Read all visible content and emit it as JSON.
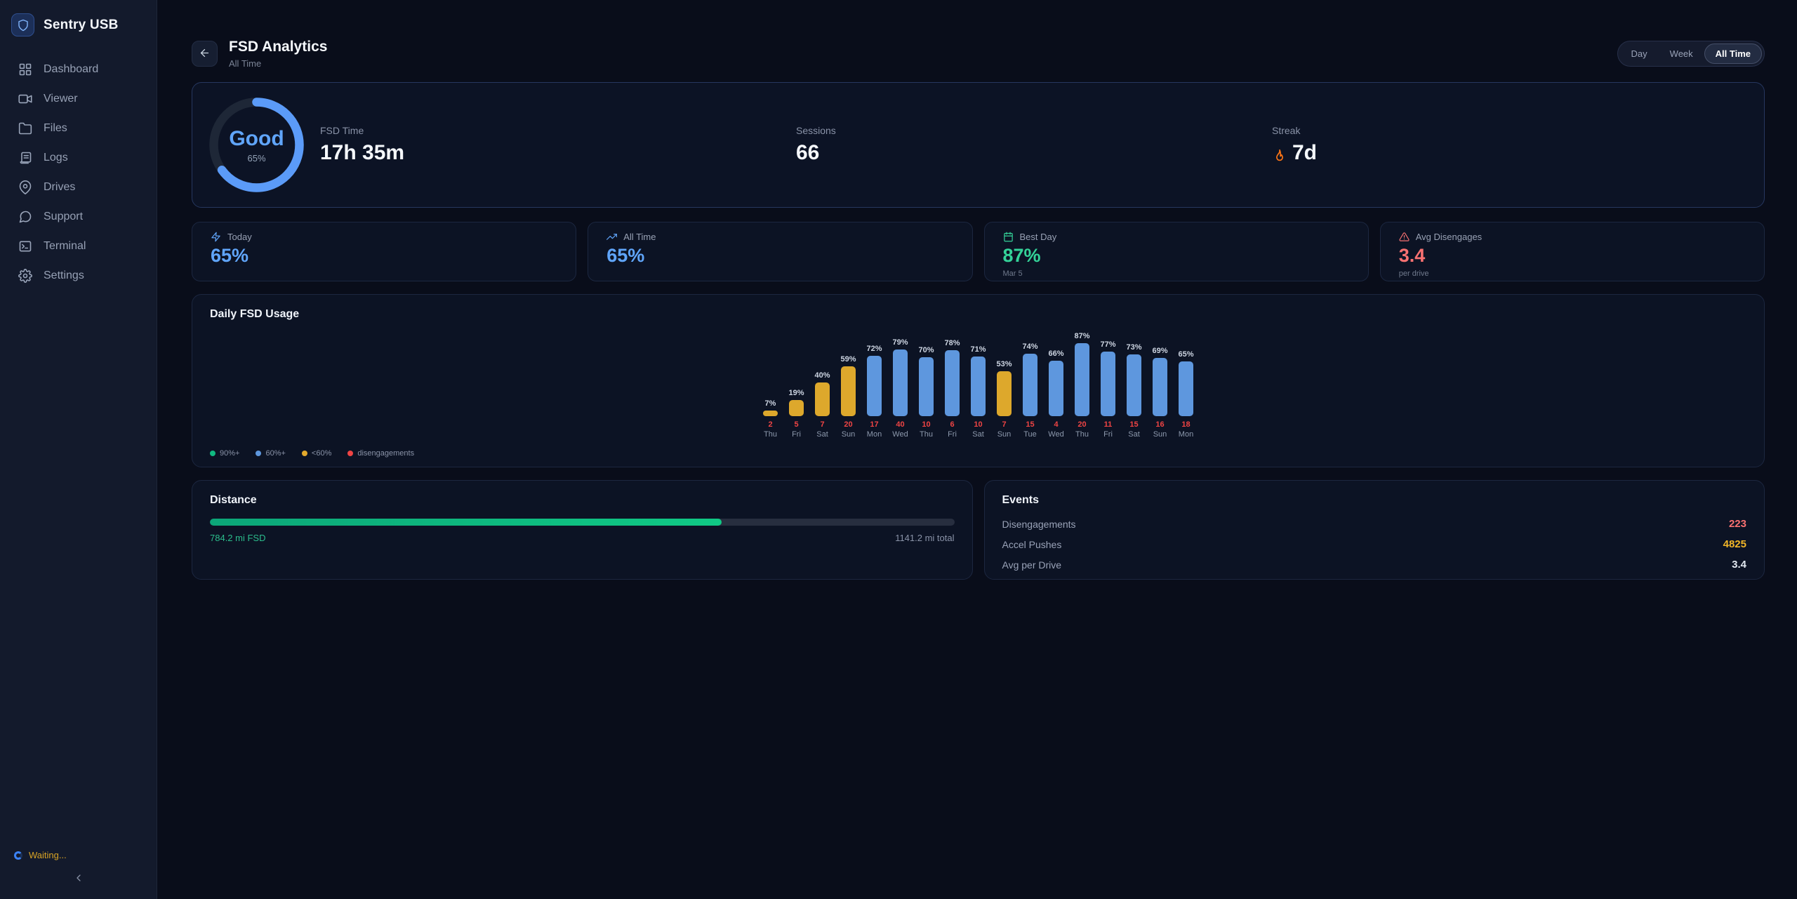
{
  "brand": "Sentry USB",
  "sidebar": {
    "items": [
      {
        "label": "Dashboard",
        "icon": "dashboard"
      },
      {
        "label": "Viewer",
        "icon": "video"
      },
      {
        "label": "Files",
        "icon": "folder"
      },
      {
        "label": "Logs",
        "icon": "logs"
      },
      {
        "label": "Drives",
        "icon": "pin"
      },
      {
        "label": "Support",
        "icon": "chat"
      },
      {
        "label": "Terminal",
        "icon": "terminal"
      },
      {
        "label": "Settings",
        "icon": "gear"
      }
    ],
    "status_text": "Waiting..."
  },
  "header": {
    "title": "FSD Analytics",
    "subtitle": "All Time",
    "ranges": [
      "Day",
      "Week",
      "All Time"
    ],
    "selected_range": "All Time"
  },
  "hero": {
    "gauge": {
      "rating": "Good",
      "percent_label": "65%",
      "percent": 65,
      "color": "#5b9bf8",
      "track_color": "#1e2737"
    },
    "stats": [
      {
        "label": "FSD Time",
        "value": "17h 35m"
      },
      {
        "label": "Sessions",
        "value": "66"
      },
      {
        "label": "Streak",
        "value": "7d",
        "icon": "flame"
      }
    ]
  },
  "stat_cards": [
    {
      "icon": "bolt",
      "label": "Today",
      "value": "65%",
      "sub": "",
      "color": "#60a5fa"
    },
    {
      "icon": "trend",
      "label": "All Time",
      "value": "65%",
      "sub": "",
      "color": "#60a5fa"
    },
    {
      "icon": "calendar",
      "label": "Best Day",
      "value": "87%",
      "sub": "Mar 5",
      "color": "#34d399"
    },
    {
      "icon": "warning",
      "label": "Avg Disengages",
      "value": "3.4",
      "sub": "per drive",
      "color": "#f87171"
    }
  ],
  "chart_data": {
    "type": "bar",
    "title": "Daily FSD Usage",
    "categories": [
      "Thu",
      "Fri",
      "Sat",
      "Sun",
      "Mon",
      "Wed",
      "Thu",
      "Fri",
      "Sat",
      "Sun",
      "Tue",
      "Wed",
      "Thu",
      "Fri",
      "Sat",
      "Sun",
      "Mon"
    ],
    "values": [
      7,
      19,
      40,
      59,
      72,
      79,
      70,
      78,
      71,
      53,
      74,
      66,
      87,
      77,
      73,
      69,
      65
    ],
    "disengagements": [
      2,
      5,
      7,
      20,
      17,
      40,
      10,
      6,
      10,
      7,
      15,
      4,
      20,
      11,
      15,
      16,
      18
    ],
    "value_suffix": "%",
    "ylim": [
      0,
      100
    ],
    "grid": false,
    "thresholds": {
      "high_min": 90,
      "mid_min": 60
    },
    "colors": {
      "high": "#10b981",
      "mid": "#5e97de",
      "low": "#dda82c",
      "disengagements": "#ef4444"
    },
    "legend": [
      {
        "label": "90%+",
        "color": "#10b981"
      },
      {
        "label": "60%+",
        "color": "#5e97de"
      },
      {
        "label": "<60%",
        "color": "#e3a92c"
      },
      {
        "label": "disengagements",
        "color": "#ef4444"
      }
    ],
    "legend_position": "bottom-left"
  },
  "distance": {
    "title": "Distance",
    "fsd_label": "784.2 mi FSD",
    "total_label": "1141.2 mi total",
    "fsd_miles": 784.2,
    "total_miles": 1141.2
  },
  "events": {
    "title": "Events",
    "rows": [
      {
        "label": "Disengagements",
        "value": "223",
        "color": "#f87171"
      },
      {
        "label": "Accel Pushes",
        "value": "4825",
        "color": "#f2b628"
      },
      {
        "label": "Avg per Drive",
        "value": "3.4",
        "color": "#e2e8f0"
      }
    ]
  }
}
